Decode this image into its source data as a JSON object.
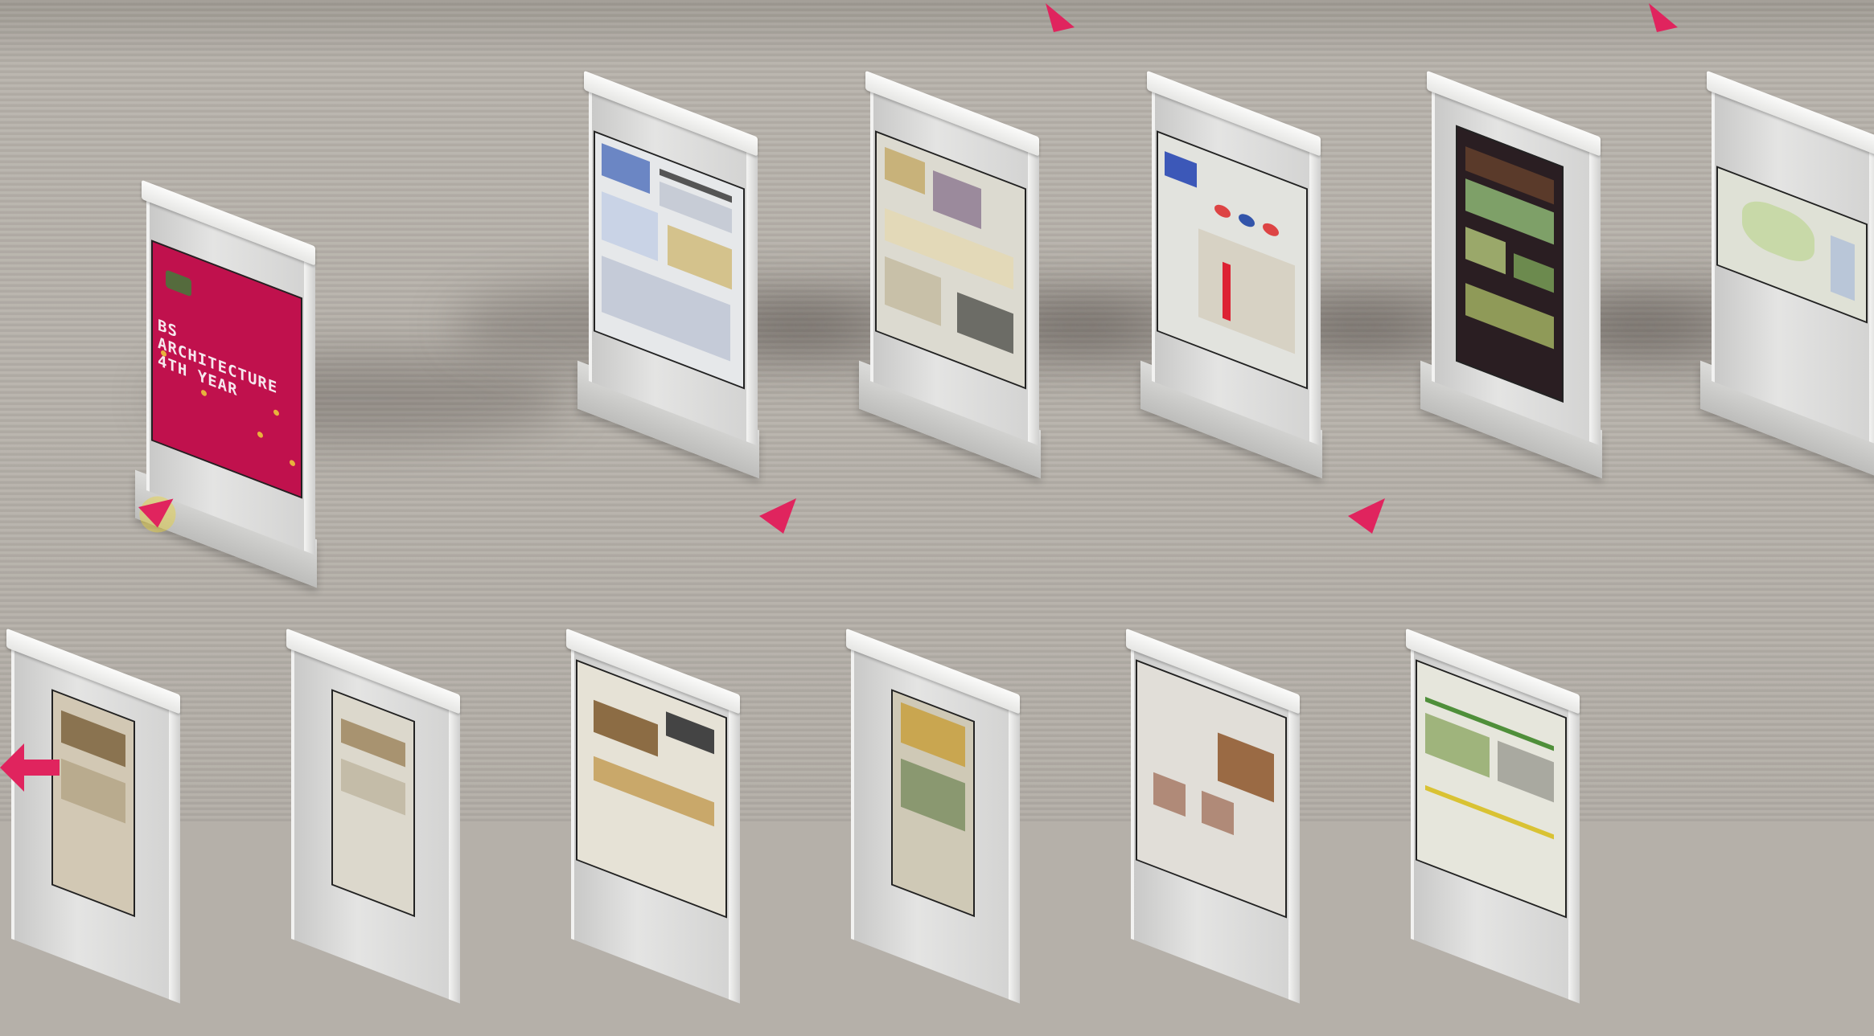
{
  "scene": {
    "featured_poster": {
      "title_line1": "BS ARCHITECTURE",
      "title_line2": "4TH YEAR"
    },
    "colors": {
      "accent": "#e0245e",
      "highlight": "#e9d33a",
      "floor": "#b5b0a9",
      "featured_poster": "#c0114d"
    }
  },
  "icons": {
    "nav_marker": "triangle-pointer-icon",
    "back": "back-arrow-icon"
  }
}
